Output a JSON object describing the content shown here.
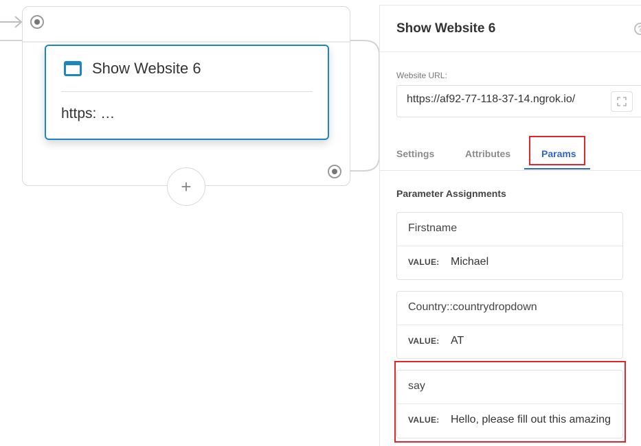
{
  "canvas": {
    "node": {
      "title": "Show Website 6",
      "url_preview": "https: …"
    },
    "add_button_label": "+"
  },
  "panel": {
    "title": "Show Website 6",
    "help_icon": "?",
    "website_url_label": "Website URL:",
    "website_url_value": "https://af92-77-118-37-14.ngrok.io/",
    "tabs": [
      {
        "label": "Settings",
        "active": false
      },
      {
        "label": "Attributes",
        "active": false
      },
      {
        "label": "Params",
        "active": true
      }
    ],
    "section_title": "Parameter Assignments",
    "params": [
      {
        "name": "Firstname",
        "value_label": "VALUE:",
        "value": "Michael"
      },
      {
        "name": "Country::countrydropdown",
        "value_label": "VALUE:",
        "value": "AT"
      },
      {
        "name": "say",
        "value_label": "VALUE:",
        "value": "Hello, please fill out this amazing"
      }
    ]
  },
  "colors": {
    "accent": "#1a86c6",
    "active_tab": "#2f65c9",
    "highlight": "#e3242b"
  },
  "icons": [
    "browser-window-icon",
    "plus-icon",
    "help-icon",
    "expand-icon",
    "port-icon"
  ]
}
